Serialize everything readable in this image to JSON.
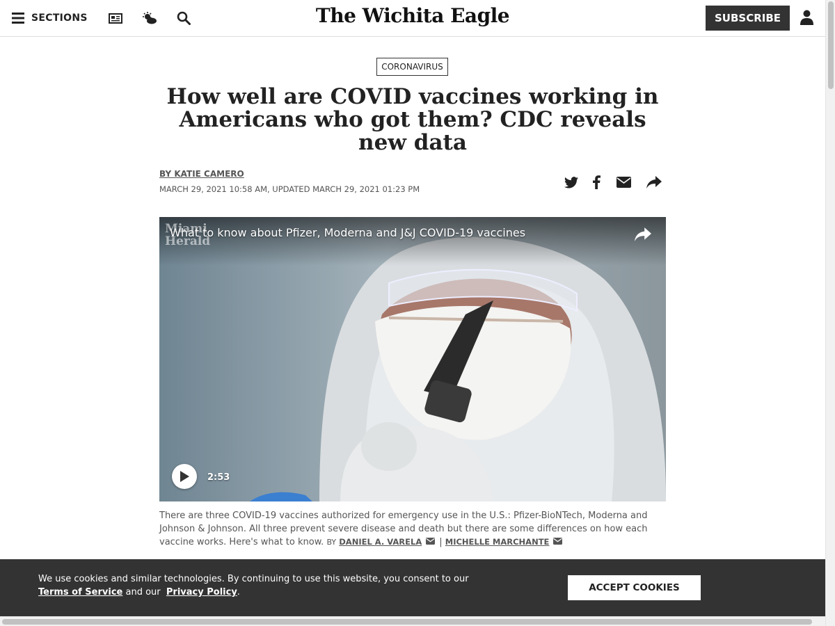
{
  "header": {
    "sections_label": "SECTIONS",
    "logo_text": "The Wichita Eagle",
    "subscribe_label": "SUBSCRIBE",
    "icons": [
      "menu-icon",
      "newspaper-icon",
      "weather-icon",
      "search-icon",
      "account-icon"
    ]
  },
  "article": {
    "kicker": "CORONAVIRUS",
    "headline": "How well are COVID vaccines working in Americans who got them? CDC reveals new data",
    "byline": "BY KATIE CAMERO",
    "dateline": "MARCH 29, 2021 10:58 AM, UPDATED MARCH 29, 2021 01:23 PM",
    "share_icons": [
      "twitter-icon",
      "facebook-icon",
      "email-icon",
      "share-icon"
    ]
  },
  "video": {
    "title": "What to know about Pfizer, Moderna and J&J COVID-19 vaccines",
    "brand": "Miami Herald",
    "duration": "2:53"
  },
  "caption": {
    "text": "There are three COVID-19 vaccines authorized for emergency use in the U.S.: Pfizer-BioNTech, Moderna and Johnson & Johnson. All three prevent severe disease and death but there are some differences on how each vaccine works. Here's what to know.",
    "by_label": "BY",
    "author1": "DANIEL A. VARELA",
    "separator": "|",
    "author2": "MICHELLE MARCHANTE"
  },
  "cookie_banner": {
    "text_before": "We use cookies and similar technologies. By continuing to use this website, you consent to our",
    "terms_link": "Terms of Service",
    "text_middle": "and our",
    "privacy_link": "Privacy Policy",
    "text_end": ".",
    "accept_label": "ACCEPT COOKIES"
  },
  "colors": {
    "dark": "#333333",
    "text": "#222222",
    "muted": "#555555"
  }
}
